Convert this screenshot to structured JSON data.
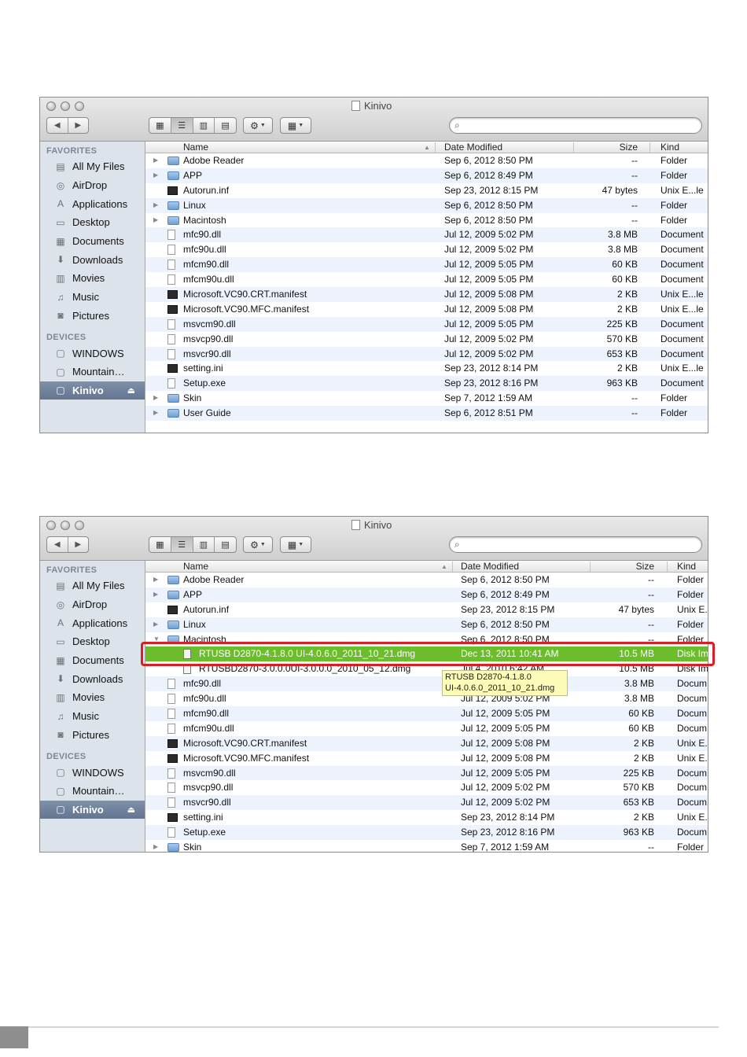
{
  "windows": [
    {
      "title": "Kinivo",
      "sidebar": {
        "favorites_title": "FAVORITES",
        "favorites": [
          {
            "label": "All My Files",
            "icon": "all-files-icon"
          },
          {
            "label": "AirDrop",
            "icon": "airdrop-icon"
          },
          {
            "label": "Applications",
            "icon": "applications-icon"
          },
          {
            "label": "Desktop",
            "icon": "desktop-icon"
          },
          {
            "label": "Documents",
            "icon": "documents-icon"
          },
          {
            "label": "Downloads",
            "icon": "downloads-icon"
          },
          {
            "label": "Movies",
            "icon": "movies-icon"
          },
          {
            "label": "Music",
            "icon": "music-icon"
          },
          {
            "label": "Pictures",
            "icon": "pictures-icon"
          }
        ],
        "devices_title": "DEVICES",
        "devices": [
          {
            "label": "WINDOWS",
            "icon": "drive-icon"
          },
          {
            "label": "Mountain…",
            "icon": "drive-icon"
          },
          {
            "label": "Kinivo",
            "icon": "drive-icon",
            "selected": true
          }
        ]
      },
      "columns": {
        "name": "Name",
        "date": "Date Modified",
        "size": "Size",
        "kind": "Kind"
      },
      "files": [
        {
          "name": "Adobe Reader",
          "date": "Sep 6, 2012 8:50 PM",
          "size": "--",
          "kind": "Folder",
          "type": "folder",
          "expander": "▶"
        },
        {
          "name": "APP",
          "date": "Sep 6, 2012 8:49 PM",
          "size": "--",
          "kind": "Folder",
          "type": "folder",
          "expander": "▶"
        },
        {
          "name": "Autorun.inf",
          "date": "Sep 23, 2012 8:15 PM",
          "size": "47 bytes",
          "kind": "Unix E...le",
          "type": "exec"
        },
        {
          "name": "Linux",
          "date": "Sep 6, 2012 8:50 PM",
          "size": "--",
          "kind": "Folder",
          "type": "folder",
          "expander": "▶"
        },
        {
          "name": "Macintosh",
          "date": "Sep 6, 2012 8:50 PM",
          "size": "--",
          "kind": "Folder",
          "type": "folder",
          "expander": "▶"
        },
        {
          "name": "mfc90.dll",
          "date": "Jul 12, 2009 5:02 PM",
          "size": "3.8 MB",
          "kind": "Document",
          "type": "doc"
        },
        {
          "name": "mfc90u.dll",
          "date": "Jul 12, 2009 5:02 PM",
          "size": "3.8 MB",
          "kind": "Document",
          "type": "doc"
        },
        {
          "name": "mfcm90.dll",
          "date": "Jul 12, 2009 5:05 PM",
          "size": "60 KB",
          "kind": "Document",
          "type": "doc"
        },
        {
          "name": "mfcm90u.dll",
          "date": "Jul 12, 2009 5:05 PM",
          "size": "60 KB",
          "kind": "Document",
          "type": "doc"
        },
        {
          "name": "Microsoft.VC90.CRT.manifest",
          "date": "Jul 12, 2009 5:08 PM",
          "size": "2 KB",
          "kind": "Unix E...le",
          "type": "exec"
        },
        {
          "name": "Microsoft.VC90.MFC.manifest",
          "date": "Jul 12, 2009 5:08 PM",
          "size": "2 KB",
          "kind": "Unix E...le",
          "type": "exec"
        },
        {
          "name": "msvcm90.dll",
          "date": "Jul 12, 2009 5:05 PM",
          "size": "225 KB",
          "kind": "Document",
          "type": "doc"
        },
        {
          "name": "msvcp90.dll",
          "date": "Jul 12, 2009 5:02 PM",
          "size": "570 KB",
          "kind": "Document",
          "type": "doc"
        },
        {
          "name": "msvcr90.dll",
          "date": "Jul 12, 2009 5:02 PM",
          "size": "653 KB",
          "kind": "Document",
          "type": "doc"
        },
        {
          "name": "setting.ini",
          "date": "Sep 23, 2012 8:14 PM",
          "size": "2 KB",
          "kind": "Unix E...le",
          "type": "exec"
        },
        {
          "name": "Setup.exe",
          "date": "Sep 23, 2012 8:16 PM",
          "size": "963 KB",
          "kind": "Document",
          "type": "doc"
        },
        {
          "name": "Skin",
          "date": "Sep 7, 2012 1:59 AM",
          "size": "--",
          "kind": "Folder",
          "type": "folder",
          "expander": "▶"
        },
        {
          "name": "User Guide",
          "date": "Sep 6, 2012 8:51 PM",
          "size": "--",
          "kind": "Folder",
          "type": "folder",
          "expander": "▶"
        }
      ]
    },
    {
      "title": "Kinivo",
      "sidebar": {
        "favorites_title": "FAVORITES",
        "favorites": [
          {
            "label": "All My Files",
            "icon": "all-files-icon"
          },
          {
            "label": "AirDrop",
            "icon": "airdrop-icon"
          },
          {
            "label": "Applications",
            "icon": "applications-icon"
          },
          {
            "label": "Desktop",
            "icon": "desktop-icon"
          },
          {
            "label": "Documents",
            "icon": "documents-icon"
          },
          {
            "label": "Downloads",
            "icon": "downloads-icon"
          },
          {
            "label": "Movies",
            "icon": "movies-icon"
          },
          {
            "label": "Music",
            "icon": "music-icon"
          },
          {
            "label": "Pictures",
            "icon": "pictures-icon"
          }
        ],
        "devices_title": "DEVICES",
        "devices": [
          {
            "label": "WINDOWS",
            "icon": "drive-icon"
          },
          {
            "label": "Mountain…",
            "icon": "drive-icon"
          },
          {
            "label": "Kinivo",
            "icon": "drive-icon",
            "selected": true
          }
        ]
      },
      "columns": {
        "name": "Name",
        "date": "Date Modified",
        "size": "Size",
        "kind": "Kind"
      },
      "files": [
        {
          "name": "Adobe Reader",
          "date": "Sep 6, 2012 8:50 PM",
          "size": "--",
          "kind": "Folder",
          "type": "folder",
          "expander": "▶"
        },
        {
          "name": "APP",
          "date": "Sep 6, 2012 8:49 PM",
          "size": "--",
          "kind": "Folder",
          "type": "folder",
          "expander": "▶"
        },
        {
          "name": "Autorun.inf",
          "date": "Sep 23, 2012 8:15 PM",
          "size": "47 bytes",
          "kind": "Unix E.",
          "type": "exec"
        },
        {
          "name": "Linux",
          "date": "Sep 6, 2012 8:50 PM",
          "size": "--",
          "kind": "Folder",
          "type": "folder",
          "expander": "▶"
        },
        {
          "name": "Macintosh",
          "date": "Sep 6, 2012 8:50 PM",
          "size": "--",
          "kind": "Folder",
          "type": "folder",
          "expander": "▼"
        },
        {
          "name": "RTUSB D2870-4.1.8.0 UI-4.0.6.0_2011_10_21.dmg",
          "date": "Dec 13, 2011 10:41 AM",
          "size": "10.5 MB",
          "kind": "Disk Im",
          "type": "dmg",
          "indent": true,
          "highlight": true
        },
        {
          "name": "RTUSBD2870-3.0.0.0UI-3.0.0.0_2010_05_12.dmg",
          "date": "Jul 4, 2010 6:42 AM",
          "size": "10.5 MB",
          "kind": "Disk Im",
          "type": "dmg",
          "indent": true
        },
        {
          "name": "mfc90.dll",
          "date": "Jul 12, 2009 5:02 PM",
          "size": "3.8 MB",
          "kind": "Docum",
          "type": "doc"
        },
        {
          "name": "mfc90u.dll",
          "date": "Jul 12, 2009 5:02 PM",
          "size": "3.8 MB",
          "kind": "Docum",
          "type": "doc"
        },
        {
          "name": "mfcm90.dll",
          "date": "Jul 12, 2009 5:05 PM",
          "size": "60 KB",
          "kind": "Docum",
          "type": "doc"
        },
        {
          "name": "mfcm90u.dll",
          "date": "Jul 12, 2009 5:05 PM",
          "size": "60 KB",
          "kind": "Docum",
          "type": "doc"
        },
        {
          "name": "Microsoft.VC90.CRT.manifest",
          "date": "Jul 12, 2009 5:08 PM",
          "size": "2 KB",
          "kind": "Unix E.",
          "type": "exec"
        },
        {
          "name": "Microsoft.VC90.MFC.manifest",
          "date": "Jul 12, 2009 5:08 PM",
          "size": "2 KB",
          "kind": "Unix E.",
          "type": "exec"
        },
        {
          "name": "msvcm90.dll",
          "date": "Jul 12, 2009 5:05 PM",
          "size": "225 KB",
          "kind": "Docum",
          "type": "doc"
        },
        {
          "name": "msvcp90.dll",
          "date": "Jul 12, 2009 5:02 PM",
          "size": "570 KB",
          "kind": "Docum",
          "type": "doc"
        },
        {
          "name": "msvcr90.dll",
          "date": "Jul 12, 2009 5:02 PM",
          "size": "653 KB",
          "kind": "Docum",
          "type": "doc"
        },
        {
          "name": "setting.ini",
          "date": "Sep 23, 2012 8:14 PM",
          "size": "2 KB",
          "kind": "Unix E.",
          "type": "exec"
        },
        {
          "name": "Setup.exe",
          "date": "Sep 23, 2012 8:16 PM",
          "size": "963 KB",
          "kind": "Docum",
          "type": "doc"
        },
        {
          "name": "Skin",
          "date": "Sep 7, 2012 1:59 AM",
          "size": "--",
          "kind": "Folder",
          "type": "folder",
          "expander": "▶"
        }
      ],
      "tooltip": [
        "RTUSB D2870-4.1.8.0",
        "UI-4.0.6.0_2011_10_21.dmg"
      ]
    }
  ],
  "colors": {
    "selection_green": "#6bbd2c",
    "highlight_red": "#d81f26",
    "sidebar_bg": "#dde3ea",
    "tooltip_bg": "#fcfcb8"
  }
}
